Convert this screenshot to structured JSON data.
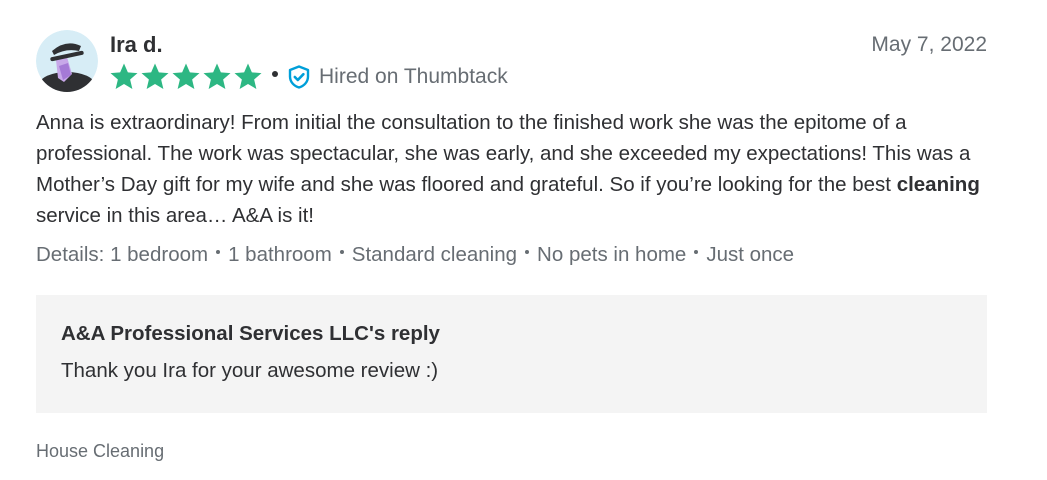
{
  "review": {
    "reviewer_name": "Ira d.",
    "date": "May 7, 2022",
    "rating": 5,
    "rating_max": 5,
    "hired_label": "Hired on Thumbtack",
    "body_before": "Anna is extraordinary! From initial the consultation to the finished work she was the epitome of a professional. The work was spectacular, she was early, and she exceeded my expectations! This was a Mother’s Day gift for my wife and she was floored and grateful. So if you’re looking for the best ",
    "body_bold": "cleaning",
    "body_after": " service in this area… A&A is it!",
    "details_prefix": "Details:",
    "details": [
      "1 bedroom",
      "1 bathroom",
      "Standard cleaning",
      "No pets in home",
      "Just once"
    ],
    "reply": {
      "title": "A&A Professional Services LLC's reply",
      "text": "Thank you Ira for your awesome review :)"
    },
    "category": "House Cleaning"
  },
  "colors": {
    "star": "#2db783",
    "shield": "#009fd9",
    "text_primary": "#2f3033",
    "text_secondary": "#676d73",
    "reply_background": "#f4f4f4"
  },
  "icons": {
    "avatar": "avatar-illustration",
    "star": "star-icon",
    "verified": "verified-shield-check-icon"
  }
}
